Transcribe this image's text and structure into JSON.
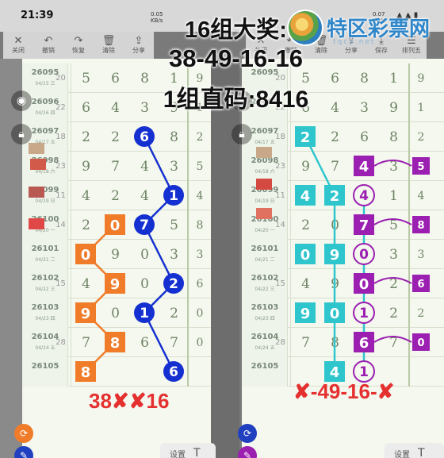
{
  "status_bar": {
    "time": "21:39",
    "left_net": "0.05\nKB/s",
    "right_net": "0.07\nKB/s",
    "right_icons": "▲ ▲ ▮"
  },
  "left_toolbar": [
    {
      "icon": "✕",
      "label": "关闭"
    },
    {
      "icon": "↶",
      "label": "撤销"
    },
    {
      "icon": "↷",
      "label": "恢复"
    },
    {
      "icon": "🗑",
      "label": "清除"
    },
    {
      "icon": "⇪",
      "label": "分享"
    }
  ],
  "right_toolbar": [
    {
      "icon": "✕",
      "label": "关闭"
    },
    {
      "icon": "↶",
      "label": "撤销"
    },
    {
      "icon": "🗑",
      "label": "清除"
    },
    {
      "icon": "⇪",
      "label": "分享"
    },
    {
      "icon": "⤓",
      "label": "保存"
    },
    {
      "icon": "☰",
      "label": "排列五"
    }
  ],
  "headline": {
    "line1": "16组大奖:",
    "line2": "38-49-16-16",
    "line3": "1组直码:8416"
  },
  "logo": {
    "text": "特区彩票网",
    "sub": "tqcp.net"
  },
  "left_rows": [
    {
      "issue": "26095",
      "date": "04/15 三",
      "miss": "20",
      "digits": [
        "5",
        "6",
        "8",
        "1"
      ],
      "side": "9"
    },
    {
      "issue": "26096",
      "date": "04/16 四",
      "miss": "22",
      "digits": [
        "6",
        "4",
        "3",
        "9"
      ],
      "side": "1"
    },
    {
      "issue": "26097",
      "date": "04/17 五",
      "miss": "18",
      "digits": [
        "2",
        "2",
        "6",
        "8"
      ],
      "side": "2"
    },
    {
      "issue": "26098",
      "date": "04/18 六",
      "miss": "23",
      "digits": [
        "9",
        "7",
        "4",
        "3"
      ],
      "side": "5"
    },
    {
      "issue": "26099",
      "date": "04/19 日",
      "miss": "11",
      "digits": [
        "4",
        "2",
        "4",
        "1"
      ],
      "side": "4"
    },
    {
      "issue": "26100",
      "date": "04/20 一",
      "miss": "14",
      "digits": [
        "2",
        "0",
        "7",
        "5"
      ],
      "side": "8"
    },
    {
      "issue": "26101",
      "date": "04/21 二",
      "miss": "",
      "digits": [
        "0",
        "9",
        "0",
        "3"
      ],
      "side": "3"
    },
    {
      "issue": "26102",
      "date": "04/22 三",
      "miss": "15",
      "digits": [
        "4",
        "9",
        "0",
        "2"
      ],
      "side": "6"
    },
    {
      "issue": "26103",
      "date": "04/23 四",
      "miss": "",
      "digits": [
        "9",
        "0",
        "1",
        "2"
      ],
      "side": "0"
    },
    {
      "issue": "26104",
      "date": "04/24 五",
      "miss": "28",
      "digits": [
        "7",
        "8",
        "6",
        "7"
      ],
      "side": "0"
    },
    {
      "issue": "26105",
      "date": "",
      "miss": "",
      "digits": [
        "8",
        "",
        "",
        "6"
      ],
      "side": ""
    }
  ],
  "right_rows": [
    {
      "issue": "26095",
      "date": "",
      "miss": "20",
      "digits": [
        "5",
        "6",
        "8",
        "1"
      ],
      "side": "9"
    },
    {
      "issue": "26096",
      "date": "",
      "miss": "22",
      "digits": [
        "6",
        "4",
        "3",
        "9"
      ],
      "side": "1"
    },
    {
      "issue": "26097",
      "date": "04/17 五",
      "miss": "18",
      "digits": [
        "2",
        "2",
        "6",
        "8"
      ],
      "side": "2"
    },
    {
      "issue": "26098",
      "date": "04/18 六",
      "miss": "23",
      "digits": [
        "9",
        "7",
        "4",
        "3"
      ],
      "side": "5"
    },
    {
      "issue": "26099",
      "date": "04/19 日",
      "miss": "11",
      "digits": [
        "4",
        "2",
        "4",
        "1"
      ],
      "side": "4"
    },
    {
      "issue": "26100",
      "date": "04/20 一",
      "miss": "14",
      "digits": [
        "2",
        "0",
        "7",
        "5"
      ],
      "side": "8"
    },
    {
      "issue": "26101",
      "date": "04/21 二",
      "miss": "",
      "digits": [
        "0",
        "9",
        "0",
        "3"
      ],
      "side": "3"
    },
    {
      "issue": "26102",
      "date": "04/22 三",
      "miss": "15",
      "digits": [
        "4",
        "9",
        "0",
        "2"
      ],
      "side": "6"
    },
    {
      "issue": "26103",
      "date": "04/23 四",
      "miss": "",
      "digits": [
        "9",
        "0",
        "1",
        "2"
      ],
      "side": "2"
    },
    {
      "issue": "26104",
      "date": "04/24 五",
      "miss": "28",
      "digits": [
        "7",
        "8",
        "6",
        "7"
      ],
      "side": "0"
    },
    {
      "issue": "26105",
      "date": "",
      "miss": "",
      "digits": [
        "",
        "4",
        "1",
        ""
      ],
      "side": ""
    }
  ],
  "result_left": {
    "a": "38",
    "x1": "✘",
    "x2": "✘",
    "b": "16"
  },
  "result_right": {
    "x1": "✘",
    "a": "-49-16-",
    "x2": "✘"
  },
  "bottom_left": {
    "label": "设置",
    "icon": "T"
  },
  "bottom_right": {
    "label": "设置",
    "icon": "T"
  },
  "colors": {
    "orange": "#f07c2a",
    "blue": "#1530d0",
    "teal": "#2ec6cc",
    "purple": "#9b1fb0",
    "red": "#e53030"
  }
}
